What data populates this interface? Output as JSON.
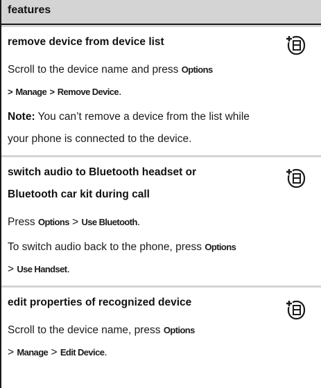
{
  "header": {
    "title": "features"
  },
  "sections": [
    {
      "title": "remove device from device list",
      "instruction": {
        "pre": "Scroll to the device name and press ",
        "cmd1": "Options",
        "line2": [
          ">",
          "Manage",
          ">",
          "Remove Device",
          "."
        ]
      },
      "note": {
        "label": "Note:",
        "line1_rest": " You can’t remove a device from the list while",
        "line2": "your phone is connected to the device."
      }
    },
    {
      "title_line1": "switch audio to Bluetooth headset or",
      "title_line2": "Bluetooth car kit during call",
      "instruction": {
        "pre": "Press ",
        "cmd1": "Options",
        "sep": " > ",
        "cmd2": "Use Bluetooth",
        "end": "."
      },
      "instruction2": {
        "line1": "To switch audio back to the phone, press ",
        "cmd1": "Options",
        "line2_pre": "> ",
        "cmd2": "Use Handset",
        "end": "."
      }
    },
    {
      "title": "edit properties of recognized device",
      "instruction": {
        "pre": "Scroll to the device name, press ",
        "cmd1": "Options",
        "line2_pre": "> ",
        "cmd2": "Manage",
        "sep": " > ",
        "cmd3": "Edit Device",
        "end": "."
      }
    }
  ],
  "icon_name": "phone-handset-plus-icon",
  "colors": {
    "header_bg": "#d4d4d4",
    "text": "#1a1a1a"
  }
}
